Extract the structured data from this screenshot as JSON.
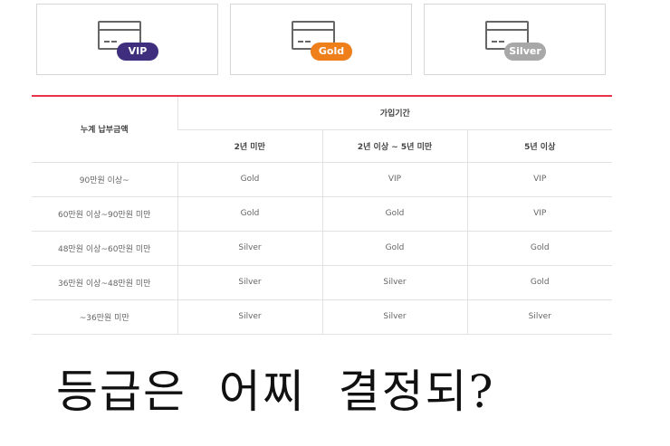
{
  "colors": {
    "vip": "#3f2e7e",
    "gold": "#ee7f1b",
    "silver": "#a8a8a8",
    "accent_line": "#e8334a"
  },
  "cards": [
    {
      "badge": "VIP",
      "icon": "credit-card-icon"
    },
    {
      "badge": "Gold",
      "icon": "credit-card-icon"
    },
    {
      "badge": "Silver",
      "icon": "credit-card-icon"
    }
  ],
  "table": {
    "row_header": "누계 납부금액",
    "group_header": "가입기간",
    "columns": [
      "2년 미만",
      "2년 이상 ~ 5년 미만",
      "5년 이상"
    ],
    "rows": [
      {
        "label": "90만원 이상~",
        "values": [
          "Gold",
          "VIP",
          "VIP"
        ]
      },
      {
        "label": "60만원 이상~90만원 미만",
        "values": [
          "Gold",
          "Gold",
          "VIP"
        ]
      },
      {
        "label": "48만원 이상~60만원 미만",
        "values": [
          "Silver",
          "Gold",
          "Gold"
        ]
      },
      {
        "label": "36만원 이상~48만원 미만",
        "values": [
          "Silver",
          "Silver",
          "Gold"
        ]
      },
      {
        "label": "~36만원 미만",
        "values": [
          "Silver",
          "Silver",
          "Silver"
        ]
      }
    ]
  },
  "caption": "등급은  어찌  결정되?"
}
